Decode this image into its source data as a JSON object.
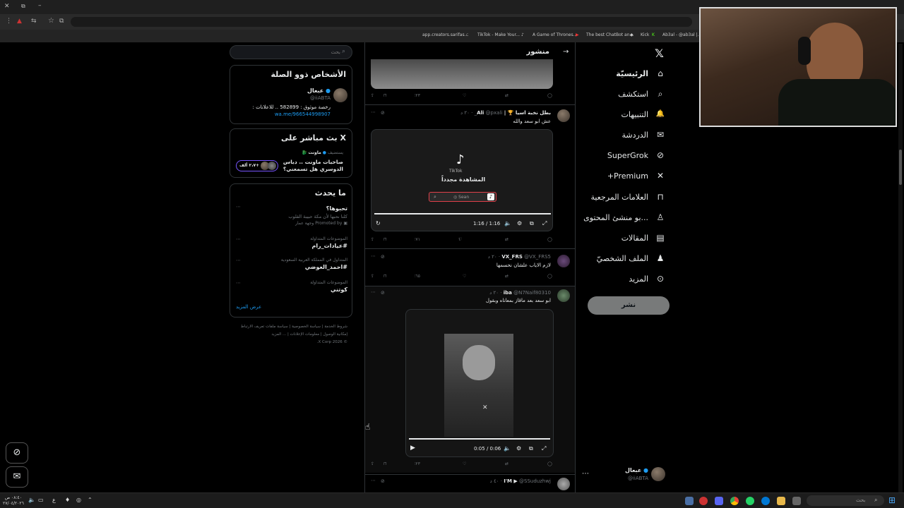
{
  "browser": {
    "bookmarks": [
      "app.creators.sarifas...",
      "TikTok - Make Your...",
      "A Game of Thrones...",
      "The best ChatBot an...",
      "Kick",
      "Ab3al - @ab3al |..."
    ]
  },
  "search": {
    "placeholder": "بحث"
  },
  "people": {
    "title": "الأشخاص ذوو الصلة",
    "name": "عبعال",
    "handle": "@iiABTA",
    "bio": "رخصة موثوق : 582899 .. للاعلانات :",
    "link": "wa.me/966544998907"
  },
  "live": {
    "title": "X بث مباشر على",
    "host_label": "يستضيف",
    "host_name": "ماونت",
    "space_title": "صاحبات ماونت .. دباس الدوسري هل تسمعني؟",
    "listeners": "٢،٧ ألف+"
  },
  "happening": {
    "title": "ما يحدث",
    "items": [
      {
        "context": "",
        "title": "تحبوها؟",
        "desc": "كلنا نحبها لأن مكة حبيبة القلوب",
        "promo": "Promoted by وجهة عمار"
      },
      {
        "context": "الموضوعات المتداولة",
        "title": "#عيادات_رام"
      },
      {
        "context": "المتداول في المملكة العربية السعودية",
        "title": "#احمد_العوضي"
      },
      {
        "context": "الموضوعات المتداولة",
        "title": "كوتني"
      }
    ],
    "show_more": "عرض المزيد"
  },
  "footer": {
    "line1": "شروط الخدمة  |  سياسة الخصوصية  |  سياسة ملفات تعريف الارتباط",
    "line2": "إمكانية الوصول  |  معلومات الإعلانات  |  ... المزيد",
    "line3": "© 2026 X Corp."
  },
  "feed": {
    "header": "منشور",
    "posts": [
      {
        "name": "بطل نخبة اسيا 🏆 | Ali",
        "handle": "@pxali_",
        "time": "٢٠ د",
        "text": "عش ابو سعد والله",
        "video": {
          "tiktok_label": "TikTok",
          "watch_again": "المشاهدة مجدداً",
          "search_text": "Sean",
          "time": "1:16 / 1:16"
        },
        "stats": {
          "views": "٧١",
          "likes": "١",
          "reposts": "",
          "replies": ""
        }
      },
      {
        "name": "VX_FRS",
        "handle": "@VX_FRS5",
        "time": "٢٠ د",
        "text": "لازم الاياب علشان نحسمها",
        "stats": {
          "views": "٦٥",
          "likes": "",
          "reposts": "",
          "replies": ""
        }
      },
      {
        "name": "iba",
        "handle": "@N7Naif80310",
        "time": "٢٠ د",
        "text": "ابو سعد بعد ماقاز بمعاناه وبقول",
        "video": {
          "time": "0:05 / 0:06"
        },
        "stats": {
          "views": "٢٣",
          "likes": "",
          "reposts": "",
          "replies": ""
        }
      },
      {
        "name": "I'M ▶",
        "handle": "@SSuduzhwj",
        "time": "٤٠ د"
      }
    ],
    "first_stats": {
      "views": "٢٣"
    }
  },
  "nav": {
    "items": [
      {
        "label": "الرئيسيّة",
        "icon": "home-icon",
        "glyph": "⌂"
      },
      {
        "label": "استكشف",
        "icon": "search-icon",
        "glyph": "⌕"
      },
      {
        "label": "التنبيهات",
        "icon": "bell-icon",
        "glyph": "🔔"
      },
      {
        "label": "الدردشة",
        "icon": "mail-icon",
        "glyph": "✉"
      },
      {
        "label": "SuperGrok",
        "icon": "grok-icon",
        "glyph": "⊘"
      },
      {
        "label": "Premium+",
        "icon": "x-logo-icon",
        "glyph": "𝕏"
      },
      {
        "label": "العلامات المرجعية",
        "icon": "bookmark-icon",
        "glyph": "⊓"
      },
      {
        "label": "...بو منشئ المحتوى",
        "icon": "creator-icon",
        "glyph": "♙"
      },
      {
        "label": "المقالات",
        "icon": "article-icon",
        "glyph": "▤"
      },
      {
        "label": "الملف الشخصيّ",
        "icon": "profile-icon",
        "glyph": "♟"
      },
      {
        "label": "المزيد",
        "icon": "more-circle-icon",
        "glyph": "⋯"
      }
    ],
    "post_button": "نشر",
    "account_name": "عبعال",
    "account_handle": "@iiABTA"
  },
  "taskbar": {
    "search_placeholder": "بحث",
    "time": "٠٨:٤٠ ص",
    "date": "٢٧/٠٤/٢٠٢٦",
    "lang": "ع"
  }
}
